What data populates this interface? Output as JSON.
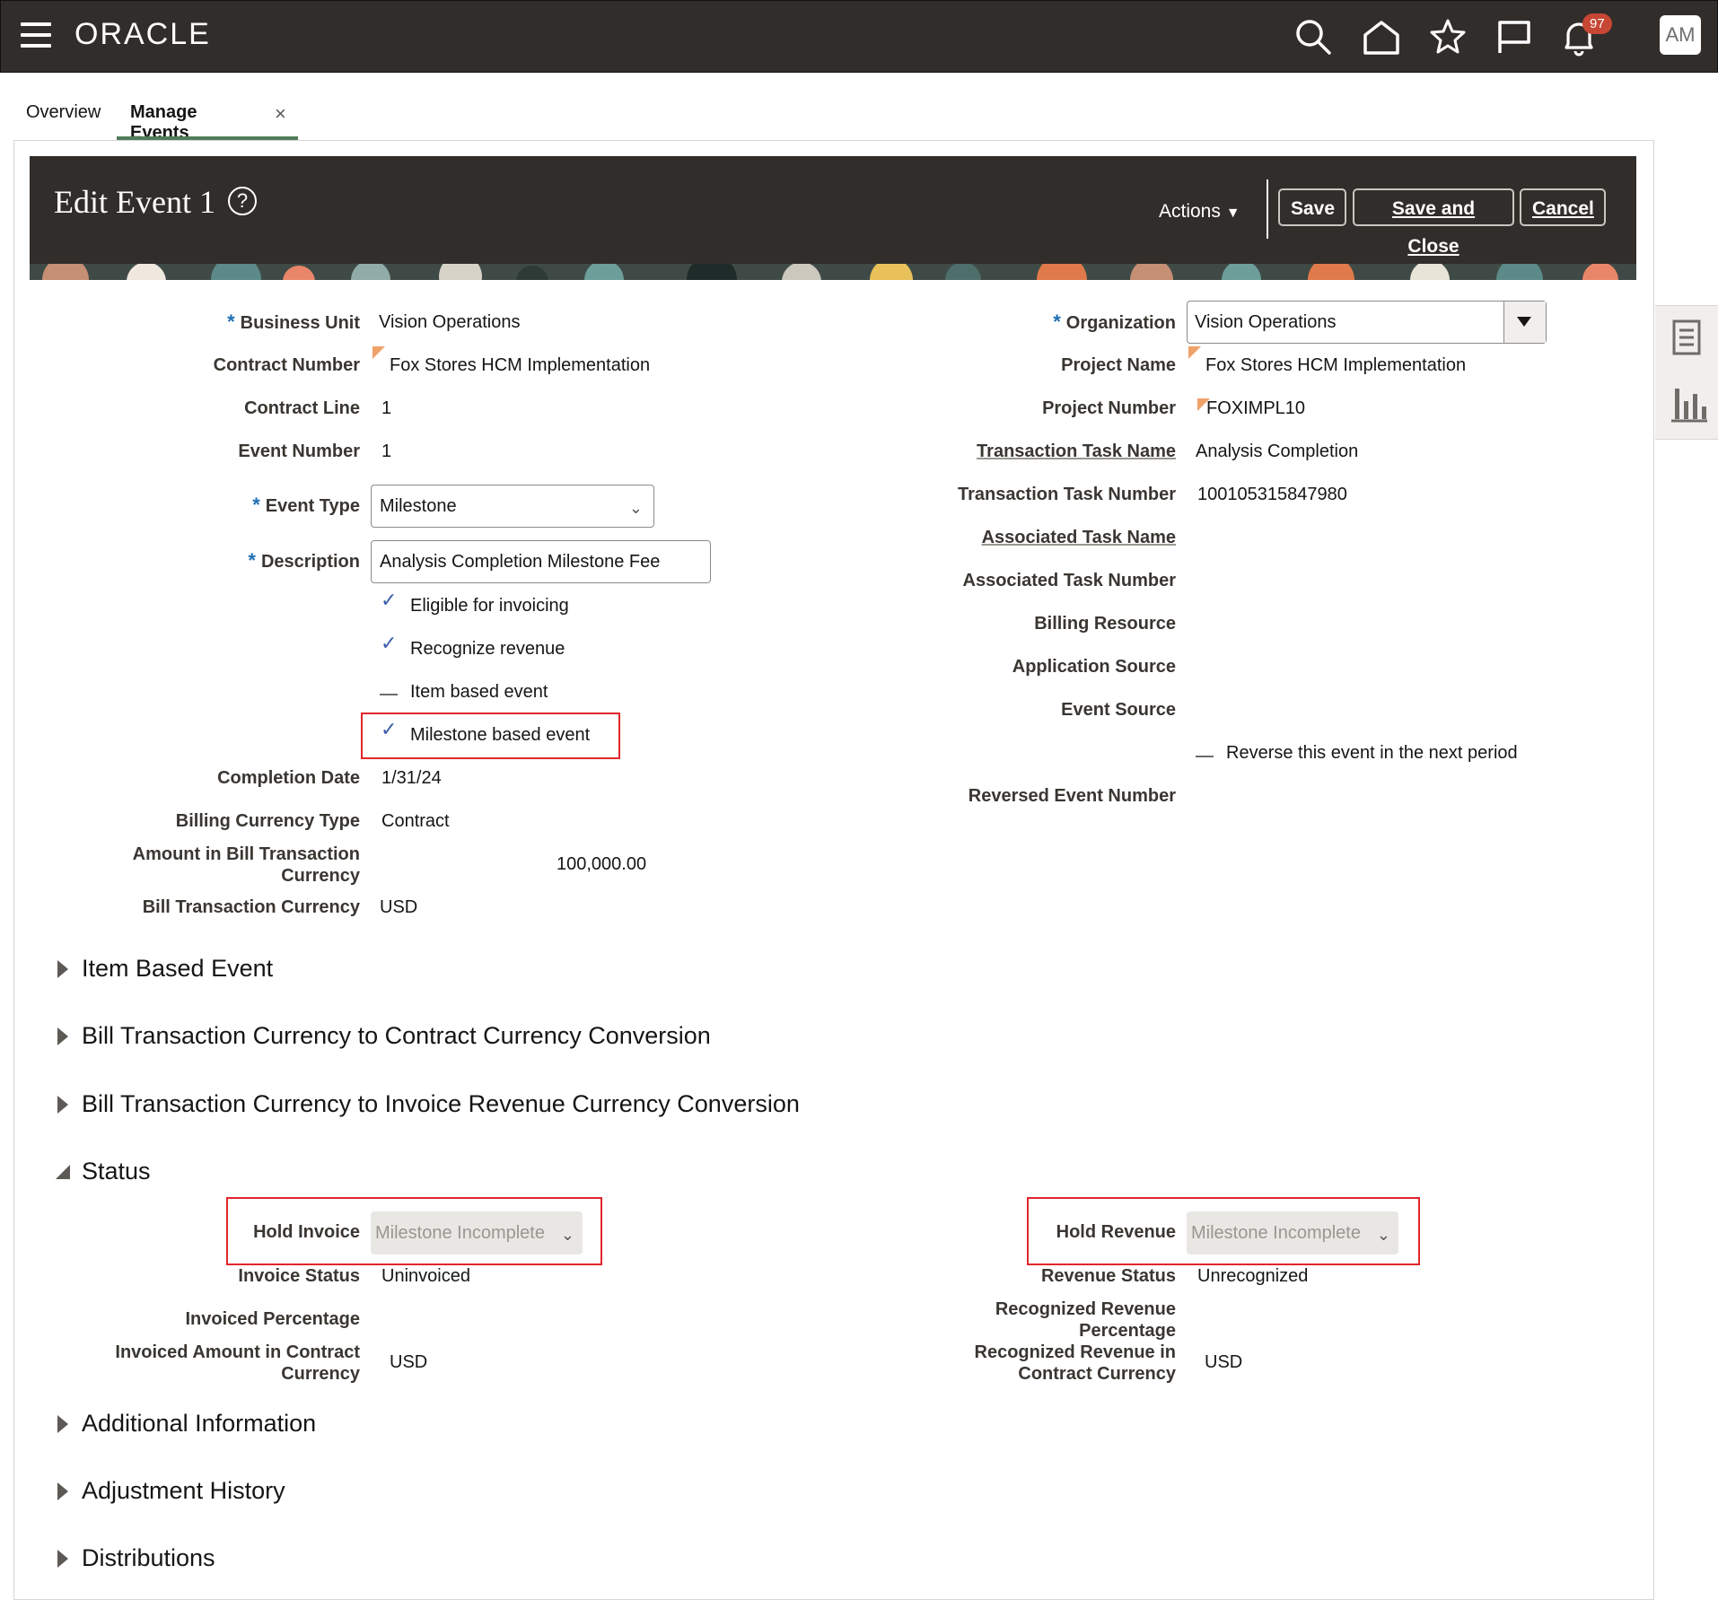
{
  "app": {
    "logo": "ORACLE",
    "notifications_count": "97",
    "user_initials": "AM"
  },
  "tabs": [
    {
      "label": "Overview"
    },
    {
      "label": "Manage Events",
      "close": "×"
    }
  ],
  "header": {
    "title": "Edit Event 1",
    "help": "?",
    "actions_label": "Actions",
    "save_label": "Save",
    "save_close_label": "Save and Close",
    "cancel_label": "Cancel"
  },
  "left_fields": {
    "business_unit": {
      "label": "Business Unit",
      "value": "Vision Operations"
    },
    "contract_number": {
      "label": "Contract Number",
      "value": "Fox Stores HCM Implementation"
    },
    "contract_line": {
      "label": "Contract Line",
      "value": "1"
    },
    "event_number": {
      "label": "Event Number",
      "value": "1"
    },
    "event_type": {
      "label": "Event Type",
      "value": "Milestone"
    },
    "description": {
      "label": "Description",
      "value": "Analysis Completion Milestone Fee"
    },
    "eligible_invoicing": {
      "label": "Eligible for invoicing",
      "checked": true
    },
    "recognize_revenue": {
      "label": "Recognize revenue",
      "checked": true
    },
    "item_based_event": {
      "label": "Item based event",
      "checked": false
    },
    "milestone_based_event": {
      "label": "Milestone based event",
      "checked": true
    },
    "completion_date": {
      "label": "Completion Date",
      "value": "1/31/24"
    },
    "billing_currency_type": {
      "label": "Billing Currency Type",
      "value": "Contract"
    },
    "amount_bill_line1": "Amount in Bill Transaction",
    "amount_bill_line2": "Currency",
    "amount_bill_value": "100,000.00",
    "bill_transaction_currency": {
      "label": "Bill Transaction Currency",
      "value": "USD"
    }
  },
  "right_fields": {
    "organization": {
      "label": "Organization",
      "value": "Vision Operations"
    },
    "project_name": {
      "label": "Project Name",
      "value": "Fox Stores HCM Implementation"
    },
    "project_number": {
      "label": "Project Number",
      "value": "FOXIMPL10"
    },
    "transaction_task_name": {
      "label": "Transaction Task Name",
      "value": "Analysis Completion"
    },
    "transaction_task_number": {
      "label": "Transaction Task Number",
      "value": "100105315847980"
    },
    "associated_task_name": {
      "label": "Associated Task Name"
    },
    "associated_task_number": {
      "label": "Associated Task Number"
    },
    "billing_resource": {
      "label": "Billing Resource"
    },
    "application_source": {
      "label": "Application Source"
    },
    "event_source": {
      "label": "Event Source"
    },
    "reverse_event": {
      "label": "Reverse this event in the next period",
      "checked": false
    },
    "reversed_event_number": {
      "label": "Reversed Event Number"
    }
  },
  "sections": {
    "item_based_event": "Item Based Event",
    "bill_to_contract": "Bill Transaction Currency to Contract Currency Conversion",
    "bill_to_invoice": "Bill Transaction Currency to Invoice Revenue Currency Conversion",
    "status": "Status",
    "additional_info": "Additional Information",
    "adjustment_history": "Adjustment History",
    "distributions": "Distributions"
  },
  "status": {
    "hold_invoice": {
      "label": "Hold Invoice",
      "value": "Milestone Incomplete"
    },
    "invoice_status": {
      "label": "Invoice Status",
      "value": "Uninvoiced"
    },
    "invoiced_percentage": {
      "label": "Invoiced Percentage"
    },
    "invoiced_amount_line1": "Invoiced Amount in Contract",
    "invoiced_amount_line2": "Currency",
    "invoiced_amount_value": "USD",
    "hold_revenue": {
      "label": "Hold Revenue",
      "value": "Milestone Incomplete"
    },
    "revenue_status": {
      "label": "Revenue Status",
      "value": "Unrecognized"
    },
    "recognized_pct_line1": "Recognized Revenue",
    "recognized_pct_line2": "Percentage",
    "recognized_amt_line1": "Recognized Revenue in",
    "recognized_amt_line2": "Contract Currency",
    "recognized_amt_value": "USD"
  },
  "icons": {
    "menu": "hamburger-icon",
    "search": "search-icon",
    "home": "home-icon",
    "favorites": "star-icon",
    "watchlist": "flag-icon",
    "notifications": "bell-icon",
    "side_1": "document-icon",
    "side_2": "bar-chart-icon"
  },
  "colors": {
    "topbar": "#312d2a",
    "required": "#1f6fb3",
    "highlight": "#e1262b",
    "check": "#3b5ea8",
    "badge": "#c74634"
  }
}
